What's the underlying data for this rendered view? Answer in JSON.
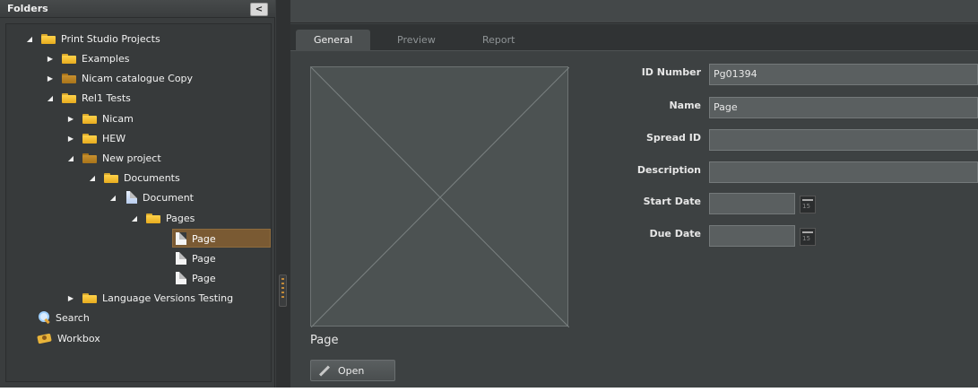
{
  "sidebar": {
    "title": "Folders",
    "collapse_glyph": "<",
    "tree": [
      {
        "label": "Print Studio Projects",
        "icon": "folder-icon"
      },
      {
        "label": "Examples",
        "icon": "folder-icon"
      },
      {
        "label": "Nicam catalogue Copy",
        "icon": "folder-brown-icon"
      },
      {
        "label": "Rel1 Tests",
        "icon": "folder-icon"
      },
      {
        "label": "Nicam",
        "icon": "folder-icon"
      },
      {
        "label": "HEW",
        "icon": "folder-icon"
      },
      {
        "label": "New project",
        "icon": "folder-brown-icon"
      },
      {
        "label": "Documents",
        "icon": "folder-icon"
      },
      {
        "label": "Document",
        "icon": "document-icon"
      },
      {
        "label": "Pages",
        "icon": "folder-icon"
      },
      {
        "label": "Page",
        "icon": "page-icon",
        "selected": true
      },
      {
        "label": "Page",
        "icon": "page-icon"
      },
      {
        "label": "Page",
        "icon": "page-icon"
      },
      {
        "label": "Language Versions Testing",
        "icon": "folder-icon"
      },
      {
        "label": "Search",
        "icon": "search-icon"
      },
      {
        "label": "Workbox",
        "icon": "workbox-icon"
      }
    ]
  },
  "tabs": [
    {
      "label": "General",
      "active": true
    },
    {
      "label": "Preview",
      "active": false
    },
    {
      "label": "Report",
      "active": false
    }
  ],
  "preview": {
    "caption": "Page",
    "open_label": "Open"
  },
  "form": {
    "id_number": {
      "label": "ID Number",
      "value": "Pg01394"
    },
    "name": {
      "label": "Name",
      "value": "Page"
    },
    "spread_id": {
      "label": "Spread ID",
      "value": ""
    },
    "description": {
      "label": "Description",
      "value": ""
    },
    "start_date": {
      "label": "Start Date",
      "value": ""
    },
    "due_date": {
      "label": "Due Date",
      "value": ""
    },
    "calendar_glyph": "15"
  },
  "colors": {
    "selection": "#7a5a33",
    "panel_bg": "#3a3d3e",
    "content_bg": "#3d4142",
    "folder": "#f2c13a"
  }
}
